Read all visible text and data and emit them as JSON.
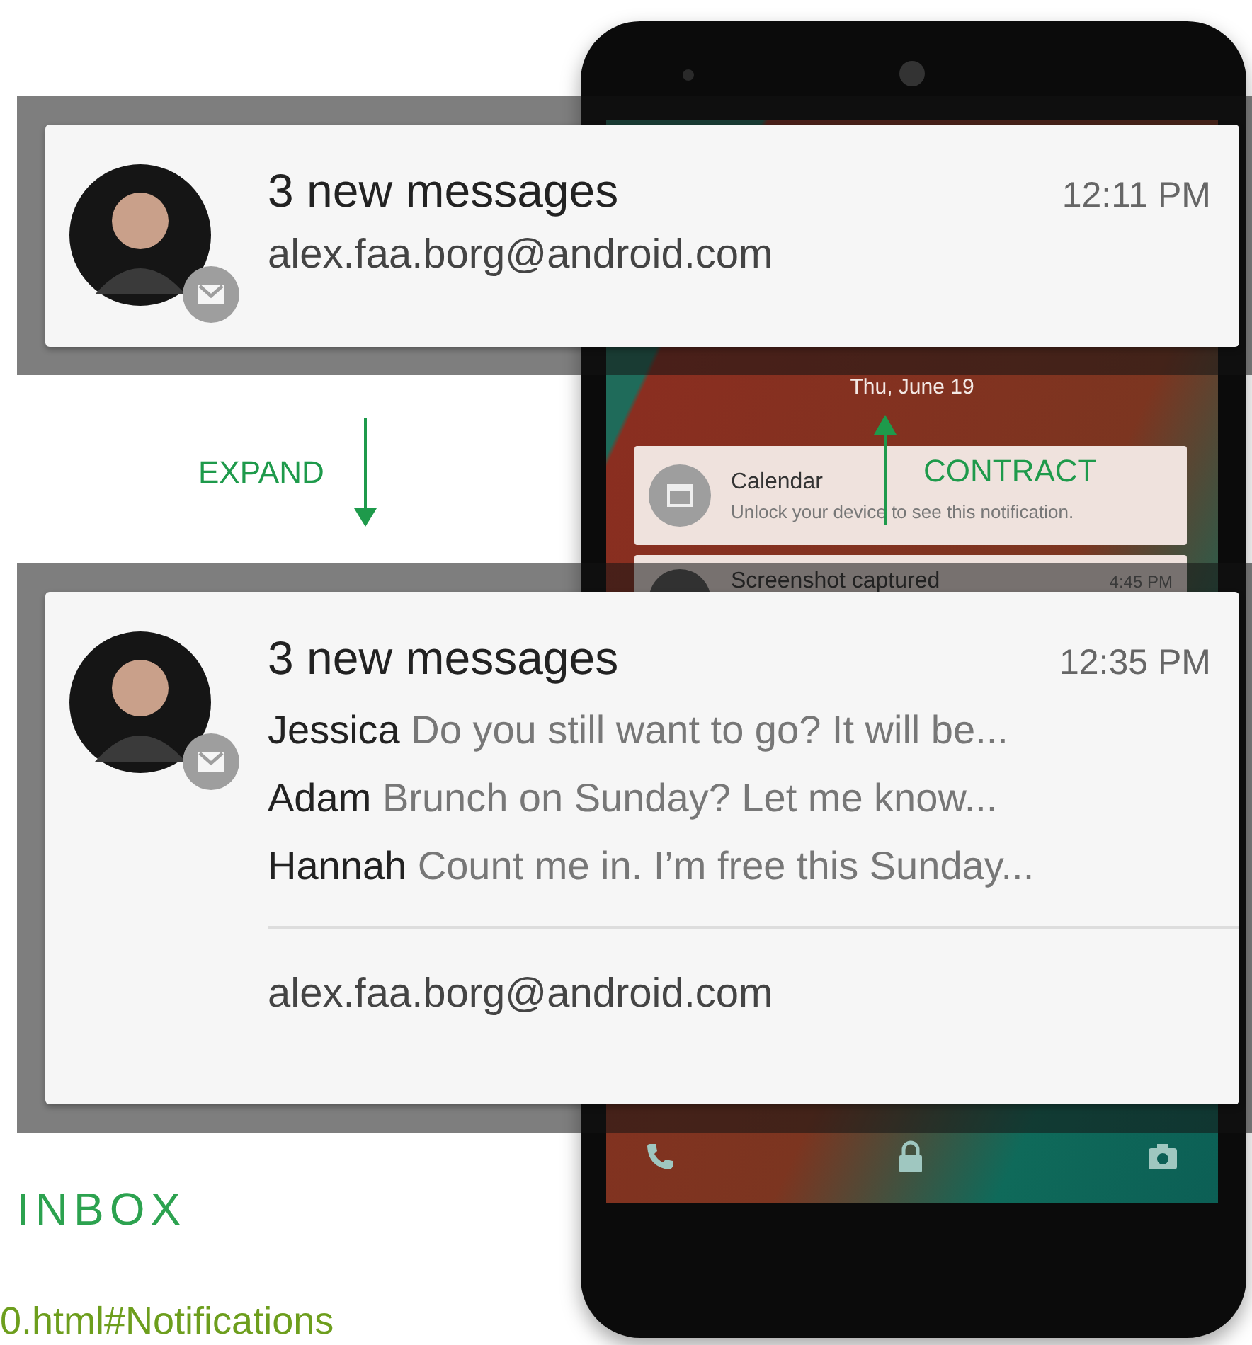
{
  "collapsed": {
    "title": "3 new messages",
    "time": "12:11 PM",
    "account": "alex.faa.borg@android.com"
  },
  "expand_label": "EXPAND",
  "contract_label": "CONTRACT",
  "lockscreen": {
    "date": "Thu, June 19",
    "notifications": [
      {
        "title": "Calendar",
        "text": "Unlock your device to see this notification."
      },
      {
        "title": "Screenshot captured",
        "time": "4:45 PM"
      }
    ]
  },
  "expanded": {
    "title": "3 new messages",
    "time": "12:35 PM",
    "messages": [
      {
        "sender": "Jessica",
        "text": "Do you still want to go? It will be..."
      },
      {
        "sender": "Adam",
        "text": "Brunch on Sunday? Let me know..."
      },
      {
        "sender": "Hannah",
        "text": "Count me in. I’m free this Sunday..."
      }
    ],
    "account": "alex.faa.borg@android.com"
  },
  "section_heading": "INBOX",
  "link": "0.html#Notifications"
}
